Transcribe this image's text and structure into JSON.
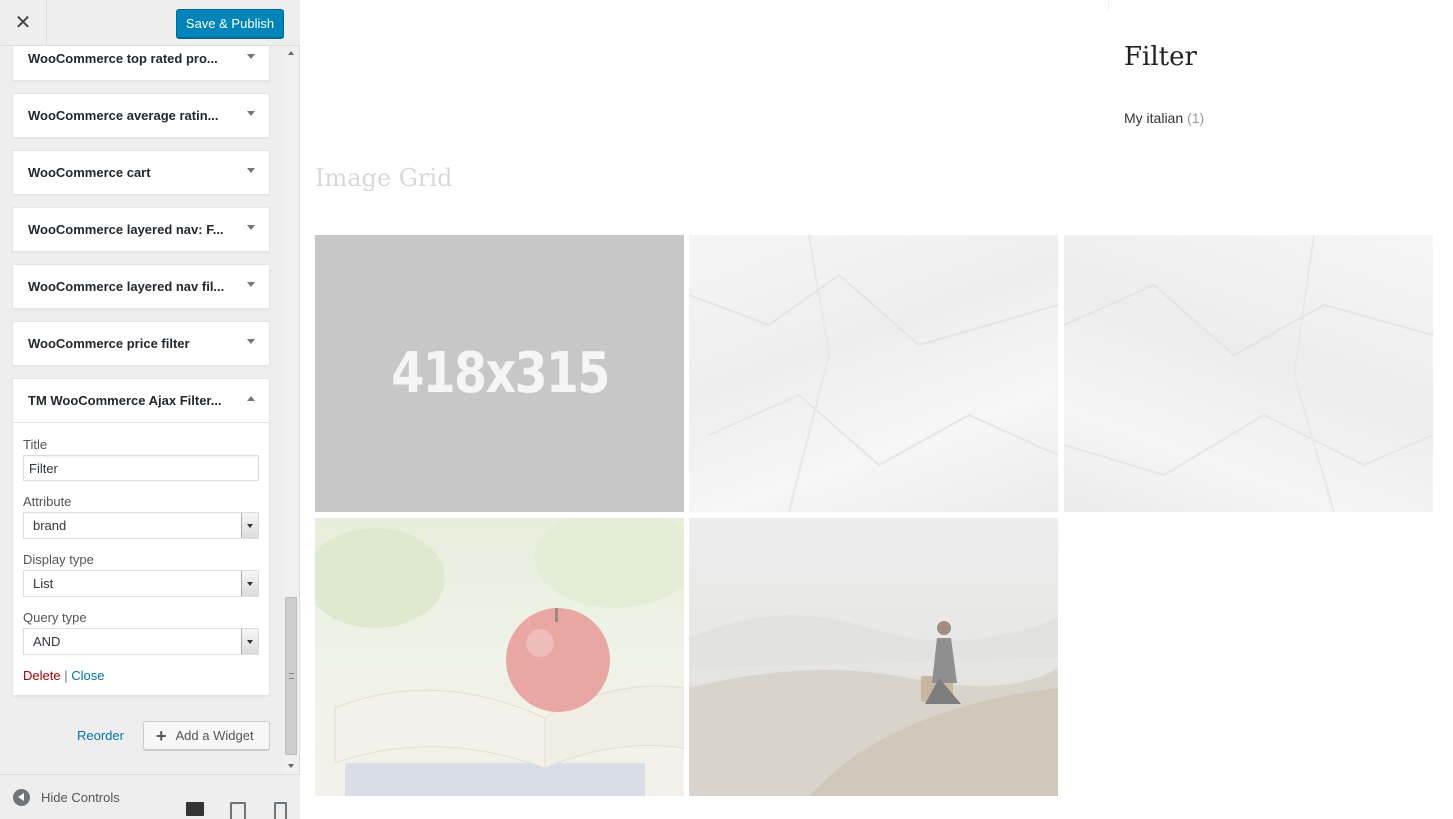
{
  "topbar": {
    "close_icon": "close-icon",
    "publish_label": "Save & Publish"
  },
  "widgets": [
    {
      "title": "WooCommerce top rated pro...",
      "state": "collapsed"
    },
    {
      "title": "WooCommerce average ratin...",
      "state": "collapsed"
    },
    {
      "title": "WooCommerce cart",
      "state": "collapsed"
    },
    {
      "title": "WooCommerce layered nav: F...",
      "state": "collapsed"
    },
    {
      "title": "WooCommerce layered nav fil...",
      "state": "collapsed"
    },
    {
      "title": "WooCommerce price filter",
      "state": "collapsed"
    },
    {
      "title": "TM WooCommerce Ajax Filter...",
      "state": "expanded"
    }
  ],
  "expanded_widget": {
    "title_label": "Title",
    "title_value": "Filter",
    "attribute_label": "Attribute",
    "attribute_value": "brand",
    "display_type_label": "Display type",
    "display_type_value": "List",
    "query_type_label": "Query type",
    "query_type_value": "AND",
    "delete_label": "Delete",
    "separator": "|",
    "close_label": "Close"
  },
  "sidebar_actions": {
    "reorder_label": "Reorder",
    "add_widget_label": "Add a Widget"
  },
  "footer": {
    "hide_controls_label": "Hide Controls",
    "devices": [
      "desktop",
      "tablet",
      "mobile"
    ],
    "active_device": "desktop"
  },
  "preview": {
    "filter_title": "Filter",
    "filter_item_label": "My italian",
    "filter_item_count": "(1)",
    "grid_title": "Image Grid",
    "placeholder_text": "418x315"
  },
  "colors": {
    "primary_button": "#0085ba",
    "link": "#0073aa",
    "delete_link": "#aa0000",
    "sidebar_bg": "#eeeeee"
  }
}
